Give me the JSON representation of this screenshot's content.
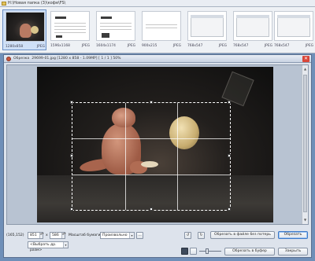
{
  "path_bar": {
    "path": "H:\\Новая папка (3)\\кофе\\FS\\"
  },
  "thumbnails": [
    {
      "size": "1280x858",
      "format": "JPEG",
      "kind": "photo",
      "selected": true
    },
    {
      "size": "1596x1168",
      "format": "JPEG",
      "kind": "document",
      "selected": false
    },
    {
      "size": "1604x1174",
      "format": "JPEG",
      "kind": "document",
      "selected": false
    },
    {
      "size": "900x215",
      "format": "JPEG",
      "kind": "document",
      "selected": false
    },
    {
      "size": "768x547",
      "format": "JPEG",
      "kind": "window",
      "selected": false
    },
    {
      "size": "768x547",
      "format": "JPEG",
      "kind": "window",
      "selected": false
    },
    {
      "size": "768x547",
      "format": "JPEG",
      "kind": "window",
      "selected": false
    }
  ],
  "dialog": {
    "title": "Обрезка",
    "file_info": "29699-01.jpg [1280 x 858 - 1.09MP] [ 1 / 1 ] 50%",
    "close_glyph": "✕"
  },
  "controls": {
    "coords": "(165,152)",
    "width_value": "851",
    "times": "x",
    "height_value": "586",
    "paper_format_label": "Масштаб бумаги",
    "paper_format_value": "Произвольно",
    "more_button": "...",
    "preset_value": "<Выбрать др. разм>",
    "crop_no_loss_button": "Обрезать в файле без потерь",
    "crop_button": "Обрезать",
    "crop_clipboard_button": "Обрезать в буфер",
    "close_button": "Закрыть",
    "rotate_left_glyph": "↺",
    "rotate_right_glyph": "↻"
  },
  "icons": {
    "folder": "folder-icon",
    "app": "app-icon",
    "close": "close-icon"
  }
}
